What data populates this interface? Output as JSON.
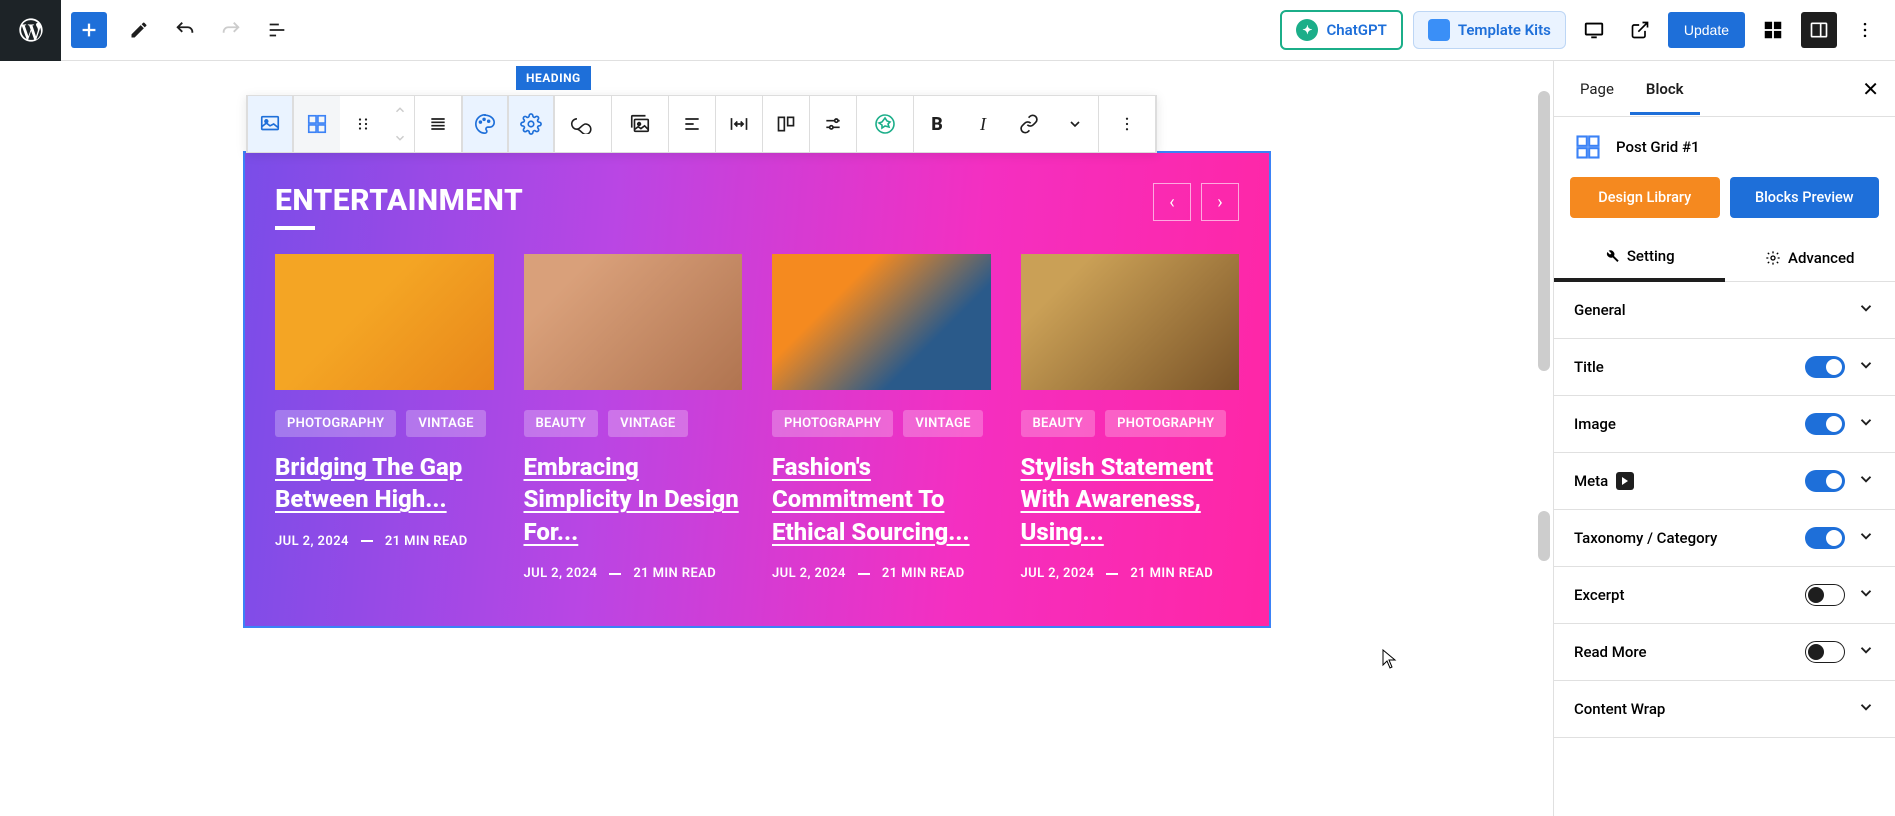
{
  "topbar": {
    "chatgpt": "ChatGPT",
    "template_kits": "Template Kits",
    "update": "Update"
  },
  "toolbar": {
    "heading_tag": "HEADING"
  },
  "section": {
    "title": "ENTERTAINMENT",
    "posts": [
      {
        "tags": [
          "PHOTOGRAPHY",
          "VINTAGE"
        ],
        "title": "Bridging The Gap Between High...",
        "date": "JUL 2, 2024",
        "read": "21 MIN READ"
      },
      {
        "tags": [
          "BEAUTY",
          "VINTAGE"
        ],
        "title": "Embracing Simplicity In Design For...",
        "date": "JUL 2, 2024",
        "read": "21 MIN READ"
      },
      {
        "tags": [
          "PHOTOGRAPHY",
          "VINTAGE"
        ],
        "title": "Fashion's Commitment To Ethical Sourcing...",
        "date": "JUL 2, 2024",
        "read": "21 MIN READ"
      },
      {
        "tags": [
          "BEAUTY",
          "PHOTOGRAPHY"
        ],
        "title": "Stylish Statement With Awareness, Using...",
        "date": "JUL 2, 2024",
        "read": "21 MIN READ"
      }
    ]
  },
  "sidebar": {
    "tab_page": "Page",
    "tab_block": "Block",
    "block_name": "Post Grid #1",
    "design_library": "Design Library",
    "blocks_preview": "Blocks Preview",
    "subtab_setting": "Setting",
    "subtab_advanced": "Advanced",
    "rows": {
      "general": "General",
      "title": "Title",
      "image": "Image",
      "meta": "Meta",
      "taxonomy": "Taxonomy / Category",
      "excerpt": "Excerpt",
      "readmore": "Read More",
      "contentwrap": "Content Wrap"
    }
  },
  "colors": {
    "primary_blue": "#1e6fd9",
    "orange": "#f5891f",
    "green": "#1bae89"
  },
  "thumbs": [
    "linear-gradient(135deg,#f4a524 40%,#e8871a 100%)",
    "linear-gradient(135deg,#d9a07a 20%,#b07450 100%)",
    "linear-gradient(135deg,#f58a1f 30%,#2a5a8a 70%)",
    "linear-gradient(135deg,#caa056 20%,#7a5428 100%)"
  ]
}
